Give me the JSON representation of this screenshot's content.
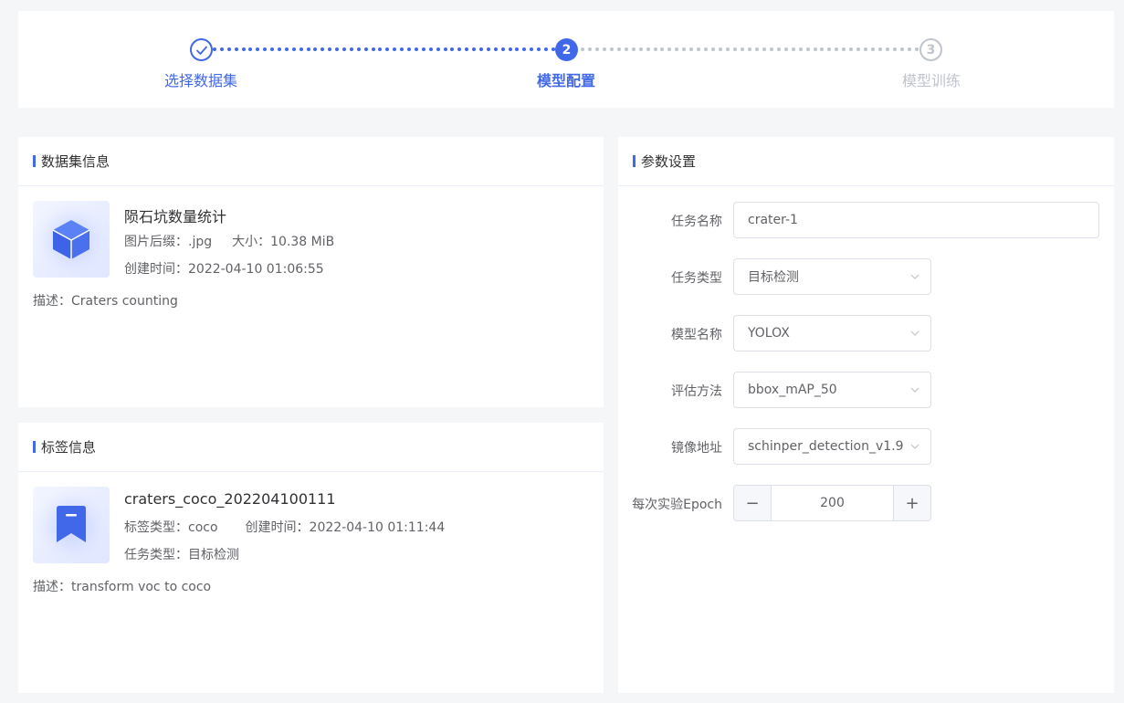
{
  "steps": [
    {
      "label": "选择数据集",
      "state": "done"
    },
    {
      "number": "2",
      "label": "模型配置",
      "state": "active"
    },
    {
      "number": "3",
      "label": "模型训练",
      "state": "pending"
    }
  ],
  "colors": {
    "accent": "#4168e8",
    "pending": "#c0c4cc",
    "text": "#303133",
    "muted": "#606266"
  },
  "dataset": {
    "header": "数据集信息",
    "name": "陨石坑数量统计",
    "suffix_label": "图片后缀：",
    "suffix": ".jpg",
    "size_label": "大小：",
    "size": "10.38 MiB",
    "created_label": "创建时间：",
    "created": "2022-04-10 01:06:55",
    "desc_label": "描述：",
    "desc": "Craters counting",
    "icon": "cube-icon"
  },
  "labelset": {
    "header": "标签信息",
    "name": "craters_coco_202204100111",
    "type_label": "标签类型：",
    "type": "coco",
    "created_label": "创建时间：",
    "created": "2022-04-10 01:11:44",
    "task_label": "任务类型：",
    "task": "目标检测",
    "desc_label": "描述：",
    "desc": "transform voc to coco",
    "icon": "bookmark-icon"
  },
  "params": {
    "header": "参数设置",
    "task_name_label": "任务名称",
    "task_name": "crater-1",
    "task_type_label": "任务类型",
    "task_type": "目标检测",
    "model_label": "模型名称",
    "model": "YOLOX",
    "eval_label": "评估方法",
    "eval": "bbox_mAP_50",
    "image_label": "镜像地址",
    "image": "schinper_detection_v1.9",
    "epoch_label": "每次实验Epoch",
    "epoch": "200",
    "minus": "−",
    "plus": "+"
  }
}
